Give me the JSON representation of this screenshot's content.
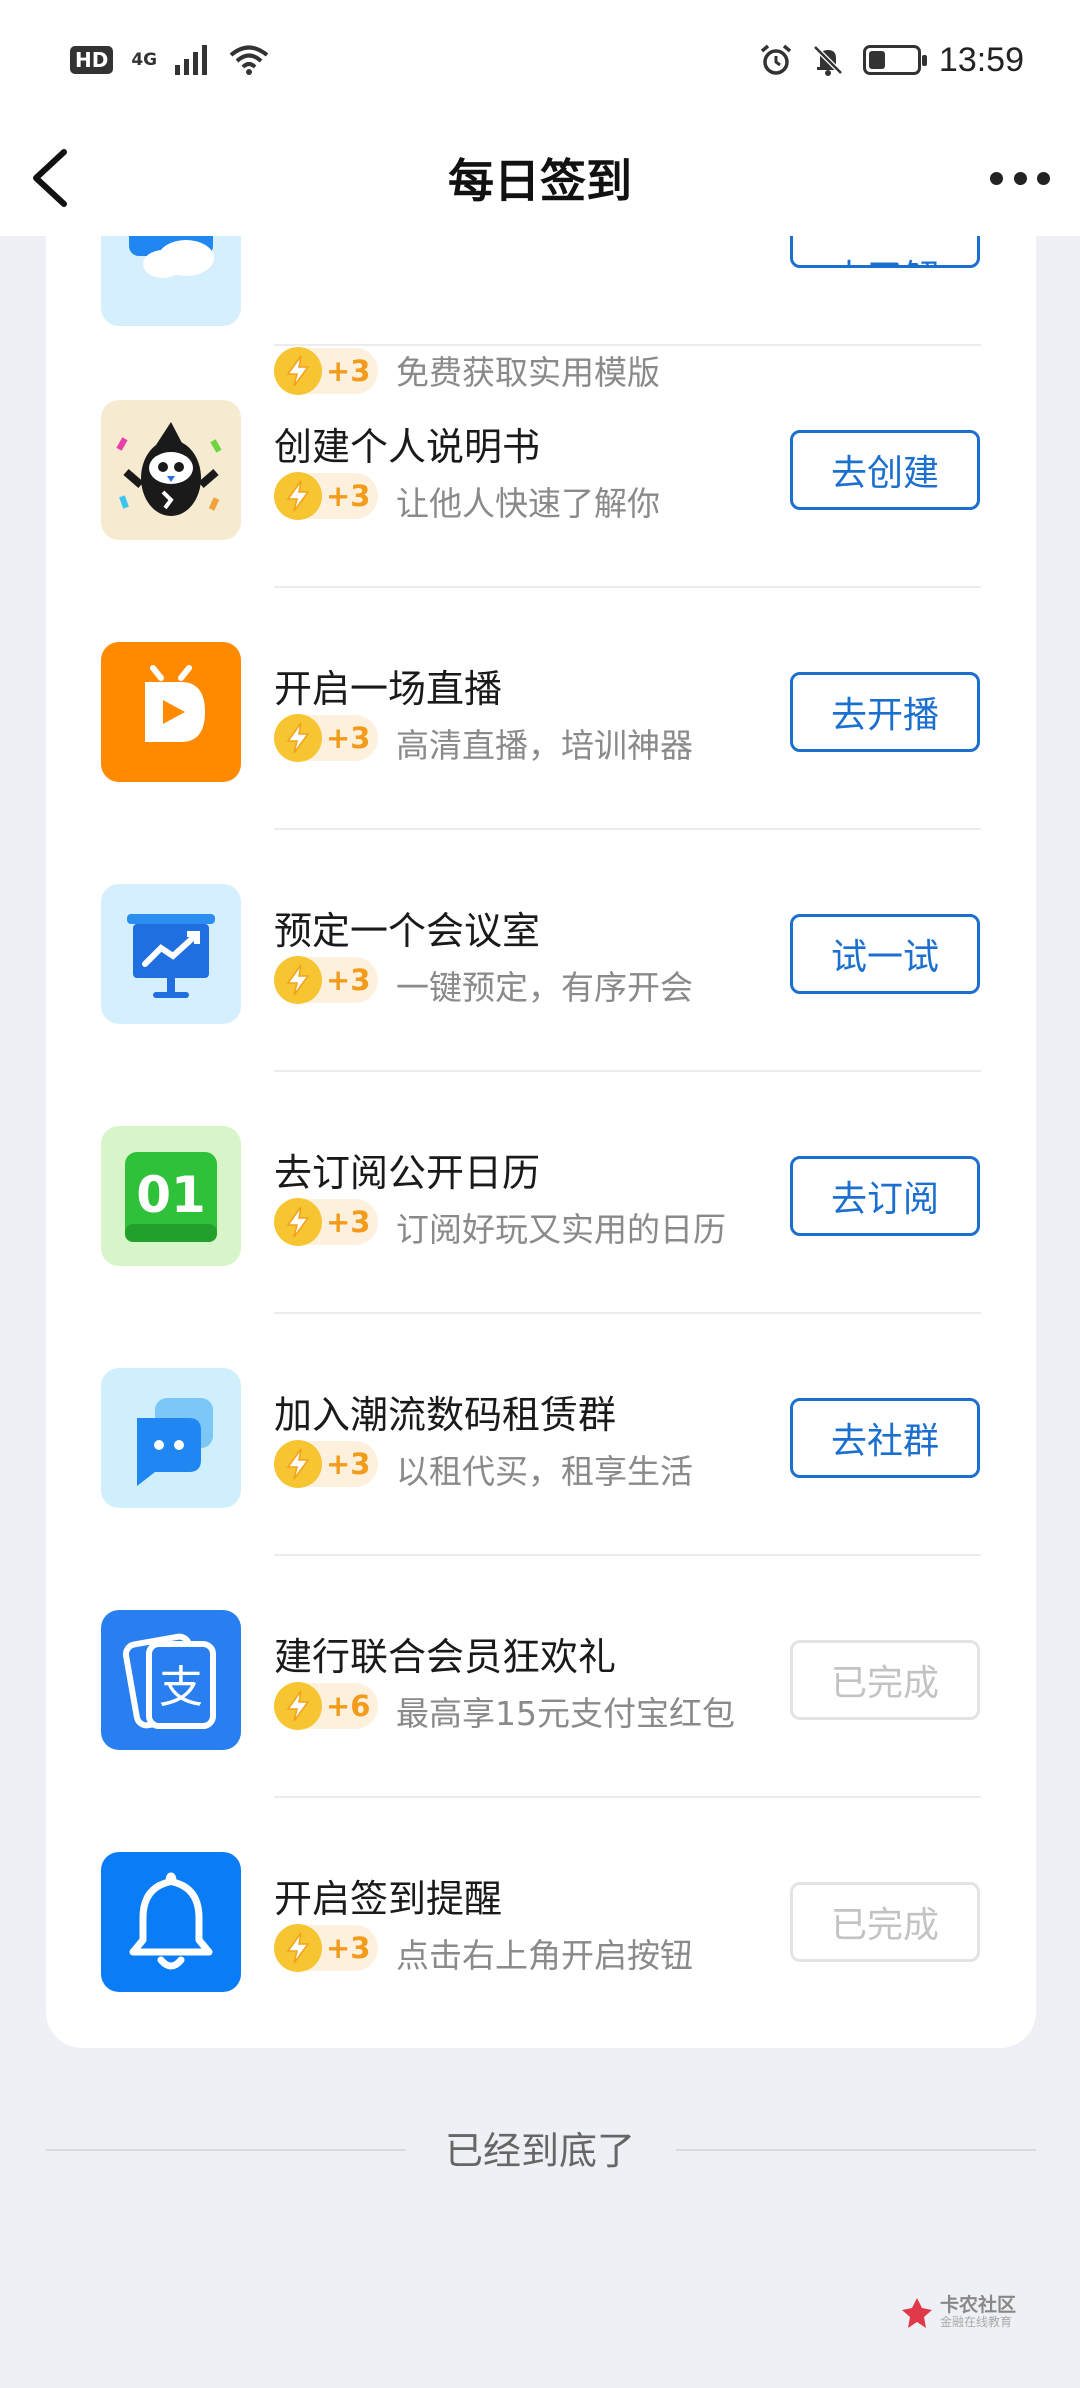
{
  "status_bar": {
    "hd": "HD",
    "network": "4G",
    "time": "13:59",
    "battery_level": 0.35
  },
  "nav": {
    "title": "每日签到"
  },
  "tasks": [
    {
      "icon": "template-cloud-icon",
      "title": "",
      "reward": "+3",
      "desc": "免费获取实用模版",
      "button": "去了解",
      "done": false
    },
    {
      "icon": "mascot-icon",
      "title": "创建个人说明书",
      "reward": "+3",
      "desc": "让他人快速了解你",
      "button": "去创建",
      "done": false
    },
    {
      "icon": "live-tv-icon",
      "title": "开启一场直播",
      "reward": "+3",
      "desc": "高清直播，培训神器",
      "button": "去开播",
      "done": false
    },
    {
      "icon": "meeting-board-icon",
      "title": "预定一个会议室",
      "reward": "+3",
      "desc": "一键预定，有序开会",
      "button": "试一试",
      "done": false
    },
    {
      "icon": "calendar-icon",
      "icon_text": "01",
      "title": "去订阅公开日历",
      "reward": "+3",
      "desc": "订阅好玩又实用的日历",
      "button": "去订阅",
      "done": false
    },
    {
      "icon": "chat-bubble-icon",
      "title": "加入潮流数码租赁群",
      "reward": "+3",
      "desc": "以租代买，租享生活",
      "button": "去社群",
      "done": false
    },
    {
      "icon": "alipay-card-icon",
      "icon_text": "支",
      "title": "建行联合会员狂欢礼",
      "reward": "+6",
      "desc": "最高享15元支付宝红包",
      "button": "已完成",
      "done": true
    },
    {
      "icon": "bell-icon",
      "title": "开启签到提醒",
      "reward": "+3",
      "desc": "点击右上角开启按钮",
      "button": "已完成",
      "done": true
    }
  ],
  "footer": {
    "text": "已经到底了"
  },
  "watermark": {
    "main": "卡农社区",
    "sub": "金融在线教育"
  }
}
